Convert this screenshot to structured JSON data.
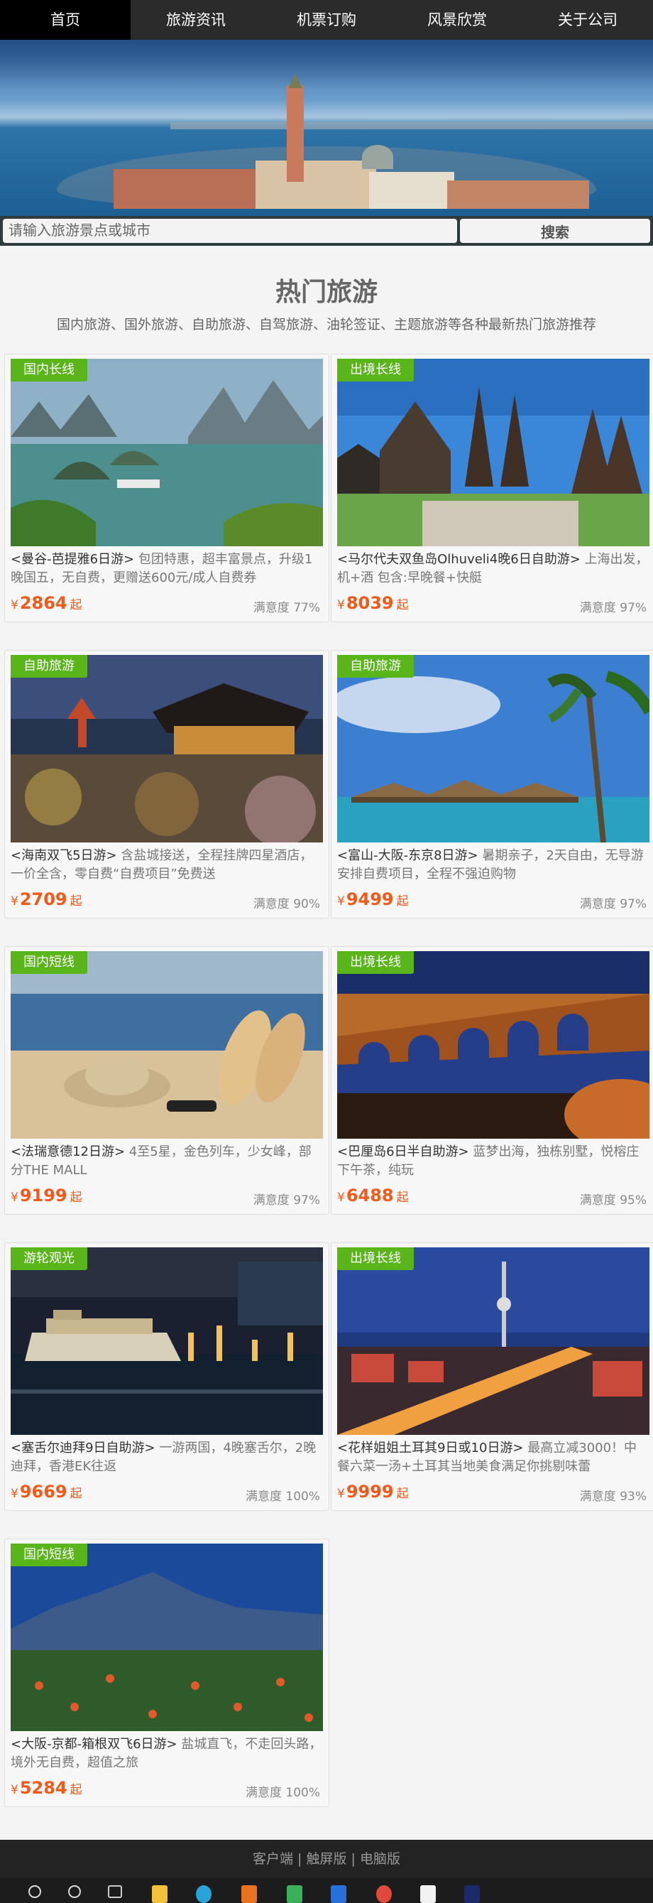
{
  "nav": {
    "items": [
      "首页",
      "旅游资讯",
      "机票订购",
      "风景欣赏",
      "关于公司"
    ]
  },
  "search": {
    "placeholder": "请输入旅游景点或城市",
    "button": "搜索"
  },
  "section": {
    "title": "热门旅游",
    "subtitle": "国内旅游、国外旅游、自助旅游、自驾旅游、油轮签证、主题旅游等各种最新热门旅游推荐"
  },
  "currency": "¥",
  "price_suffix": "起",
  "cards": [
    {
      "tag": "国内长线",
      "name": "<曼谷-芭提雅6日游>",
      "text": " 包团特惠，超丰富景点，升级1晚国五，无自费，更赠送600元/成人自费券",
      "price": "2864",
      "satisfaction": "满意度 77%"
    },
    {
      "tag": "出境长线",
      "name": "<马尔代夫双鱼岛Olhuveli4晚6日自助游>",
      "text": " 上海出发，机+酒 包含:早晚餐+快艇",
      "price": "8039",
      "satisfaction": "满意度 97%"
    },
    {
      "tag": "自助旅游",
      "name": "<海南双飞5日游>",
      "text": " 含盐城接送，全程挂牌四星酒店，一价全含，零自费“自费项目”免费送",
      "price": "2709",
      "satisfaction": "满意度 90%"
    },
    {
      "tag": "自助旅游",
      "name": "<富山-大阪-东京8日游>",
      "text": " 暑期亲子，2天自由，无导游安排自费项目，全程不强迫购物",
      "price": "9499",
      "satisfaction": "满意度 97%"
    },
    {
      "tag": "国内短线",
      "name": "<法瑞意德12日游>",
      "text": " 4至5星，金色列车，少女峰，部分THE MALL",
      "price": "9199",
      "satisfaction": "满意度 97%"
    },
    {
      "tag": "出境长线",
      "name": "<巴厘岛6日半自助游>",
      "text": " 蓝梦出海，独栋别墅，悦榕庄下午茶，纯玩",
      "price": "6488",
      "satisfaction": "满意度 95%"
    },
    {
      "tag": "游轮观光",
      "name": "<塞舌尔迪拜9日自助游>",
      "text": " 一游两国，4晚塞舌尔，2晚迪拜，香港EK往返",
      "price": "9669",
      "satisfaction": "满意度 100%"
    },
    {
      "tag": "出境长线",
      "name": "<花样姐姐土耳其9日或10日游>",
      "text": " 最高立减3000！中餐六菜一汤+土耳其当地美食满足你挑剔味蕾",
      "price": "9999",
      "satisfaction": "满意度 93%"
    },
    {
      "tag": "国内短线",
      "name": "<大阪-京都-箱根双飞6日游>",
      "text": " 盐城直飞，不走回头路，境外无自费，超值之旅",
      "price": "5284",
      "satisfaction": "满意度 100%"
    }
  ],
  "footer": {
    "links": [
      "客户端",
      "触屏版",
      "电脑版"
    ],
    "separator": " | "
  }
}
